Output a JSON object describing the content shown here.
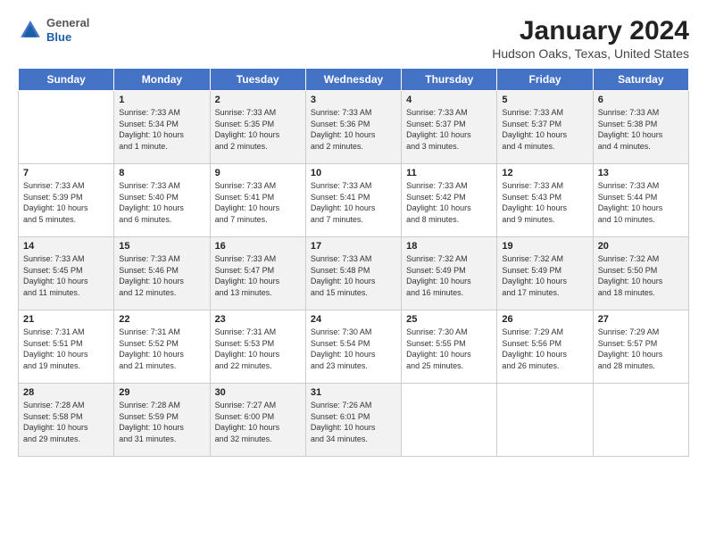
{
  "header": {
    "logo": {
      "general": "General",
      "blue": "Blue"
    },
    "title": "January 2024",
    "subtitle": "Hudson Oaks, Texas, United States"
  },
  "days_of_week": [
    "Sunday",
    "Monday",
    "Tuesday",
    "Wednesday",
    "Thursday",
    "Friday",
    "Saturday"
  ],
  "weeks": [
    [
      {
        "num": "",
        "info": ""
      },
      {
        "num": "1",
        "info": "Sunrise: 7:33 AM\nSunset: 5:34 PM\nDaylight: 10 hours\nand 1 minute."
      },
      {
        "num": "2",
        "info": "Sunrise: 7:33 AM\nSunset: 5:35 PM\nDaylight: 10 hours\nand 2 minutes."
      },
      {
        "num": "3",
        "info": "Sunrise: 7:33 AM\nSunset: 5:36 PM\nDaylight: 10 hours\nand 2 minutes."
      },
      {
        "num": "4",
        "info": "Sunrise: 7:33 AM\nSunset: 5:37 PM\nDaylight: 10 hours\nand 3 minutes."
      },
      {
        "num": "5",
        "info": "Sunrise: 7:33 AM\nSunset: 5:37 PM\nDaylight: 10 hours\nand 4 minutes."
      },
      {
        "num": "6",
        "info": "Sunrise: 7:33 AM\nSunset: 5:38 PM\nDaylight: 10 hours\nand 4 minutes."
      }
    ],
    [
      {
        "num": "7",
        "info": "Sunrise: 7:33 AM\nSunset: 5:39 PM\nDaylight: 10 hours\nand 5 minutes."
      },
      {
        "num": "8",
        "info": "Sunrise: 7:33 AM\nSunset: 5:40 PM\nDaylight: 10 hours\nand 6 minutes."
      },
      {
        "num": "9",
        "info": "Sunrise: 7:33 AM\nSunset: 5:41 PM\nDaylight: 10 hours\nand 7 minutes."
      },
      {
        "num": "10",
        "info": "Sunrise: 7:33 AM\nSunset: 5:41 PM\nDaylight: 10 hours\nand 7 minutes."
      },
      {
        "num": "11",
        "info": "Sunrise: 7:33 AM\nSunset: 5:42 PM\nDaylight: 10 hours\nand 8 minutes."
      },
      {
        "num": "12",
        "info": "Sunrise: 7:33 AM\nSunset: 5:43 PM\nDaylight: 10 hours\nand 9 minutes."
      },
      {
        "num": "13",
        "info": "Sunrise: 7:33 AM\nSunset: 5:44 PM\nDaylight: 10 hours\nand 10 minutes."
      }
    ],
    [
      {
        "num": "14",
        "info": "Sunrise: 7:33 AM\nSunset: 5:45 PM\nDaylight: 10 hours\nand 11 minutes."
      },
      {
        "num": "15",
        "info": "Sunrise: 7:33 AM\nSunset: 5:46 PM\nDaylight: 10 hours\nand 12 minutes."
      },
      {
        "num": "16",
        "info": "Sunrise: 7:33 AM\nSunset: 5:47 PM\nDaylight: 10 hours\nand 13 minutes."
      },
      {
        "num": "17",
        "info": "Sunrise: 7:33 AM\nSunset: 5:48 PM\nDaylight: 10 hours\nand 15 minutes."
      },
      {
        "num": "18",
        "info": "Sunrise: 7:32 AM\nSunset: 5:49 PM\nDaylight: 10 hours\nand 16 minutes."
      },
      {
        "num": "19",
        "info": "Sunrise: 7:32 AM\nSunset: 5:49 PM\nDaylight: 10 hours\nand 17 minutes."
      },
      {
        "num": "20",
        "info": "Sunrise: 7:32 AM\nSunset: 5:50 PM\nDaylight: 10 hours\nand 18 minutes."
      }
    ],
    [
      {
        "num": "21",
        "info": "Sunrise: 7:31 AM\nSunset: 5:51 PM\nDaylight: 10 hours\nand 19 minutes."
      },
      {
        "num": "22",
        "info": "Sunrise: 7:31 AM\nSunset: 5:52 PM\nDaylight: 10 hours\nand 21 minutes."
      },
      {
        "num": "23",
        "info": "Sunrise: 7:31 AM\nSunset: 5:53 PM\nDaylight: 10 hours\nand 22 minutes."
      },
      {
        "num": "24",
        "info": "Sunrise: 7:30 AM\nSunset: 5:54 PM\nDaylight: 10 hours\nand 23 minutes."
      },
      {
        "num": "25",
        "info": "Sunrise: 7:30 AM\nSunset: 5:55 PM\nDaylight: 10 hours\nand 25 minutes."
      },
      {
        "num": "26",
        "info": "Sunrise: 7:29 AM\nSunset: 5:56 PM\nDaylight: 10 hours\nand 26 minutes."
      },
      {
        "num": "27",
        "info": "Sunrise: 7:29 AM\nSunset: 5:57 PM\nDaylight: 10 hours\nand 28 minutes."
      }
    ],
    [
      {
        "num": "28",
        "info": "Sunrise: 7:28 AM\nSunset: 5:58 PM\nDaylight: 10 hours\nand 29 minutes."
      },
      {
        "num": "29",
        "info": "Sunrise: 7:28 AM\nSunset: 5:59 PM\nDaylight: 10 hours\nand 31 minutes."
      },
      {
        "num": "30",
        "info": "Sunrise: 7:27 AM\nSunset: 6:00 PM\nDaylight: 10 hours\nand 32 minutes."
      },
      {
        "num": "31",
        "info": "Sunrise: 7:26 AM\nSunset: 6:01 PM\nDaylight: 10 hours\nand 34 minutes."
      },
      {
        "num": "",
        "info": ""
      },
      {
        "num": "",
        "info": ""
      },
      {
        "num": "",
        "info": ""
      }
    ]
  ]
}
